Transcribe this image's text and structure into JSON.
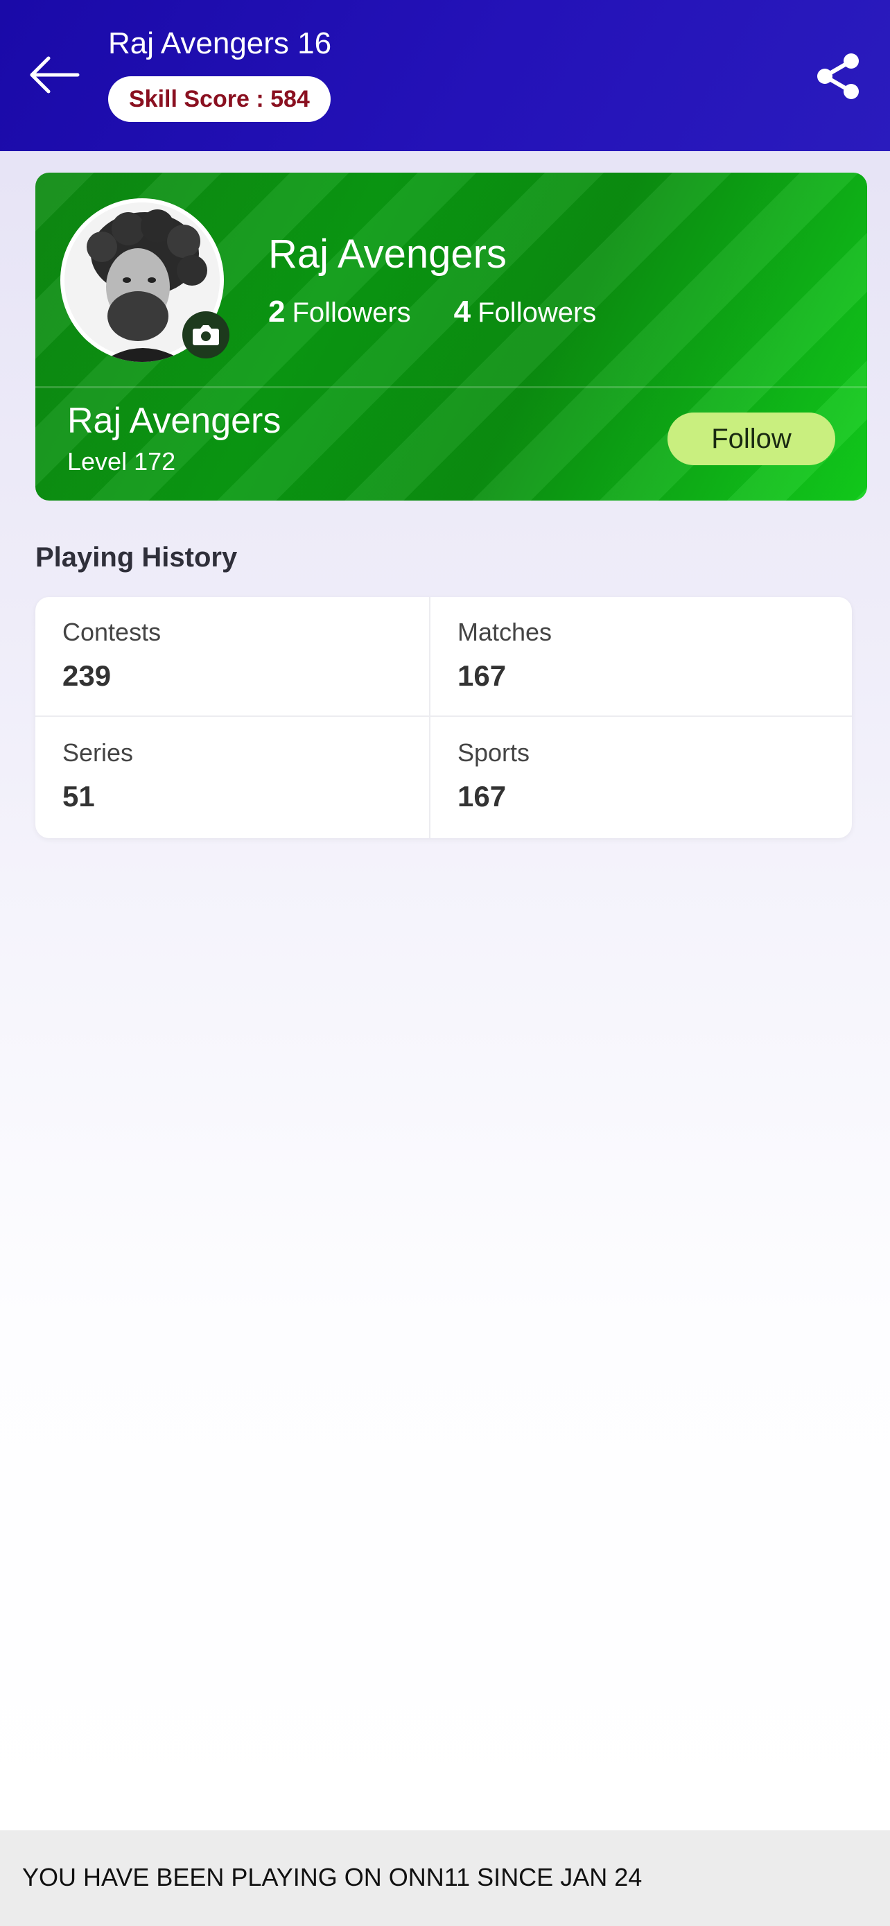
{
  "header": {
    "title": "Raj Avengers 16",
    "skill_score": "Skill Score : 584",
    "back_icon": "back-arrow-icon",
    "share_icon": "share-icon"
  },
  "profile": {
    "name": "Raj Avengers",
    "followers": [
      {
        "count": "2",
        "label": "Followers"
      },
      {
        "count": "4",
        "label": "Followers"
      }
    ],
    "name_secondary": "Raj Avengers",
    "level": "Level 172",
    "follow_label": "Follow",
    "camera_icon": "camera-icon"
  },
  "playing_history": {
    "title": "Playing History",
    "stats": [
      {
        "label": "Contests",
        "value": "239"
      },
      {
        "label": "Matches",
        "value": "167"
      },
      {
        "label": "Series",
        "value": "51"
      },
      {
        "label": "Sports",
        "value": "167"
      }
    ]
  },
  "footer": {
    "text": "YOU HAVE BEEN PLAYING ON ONN11 SINCE JAN 24"
  },
  "colors": {
    "header": "#2412b8",
    "card_green": "#0a9a12",
    "follow_button": "#c9ef7f",
    "skill_text": "#8a1020"
  }
}
